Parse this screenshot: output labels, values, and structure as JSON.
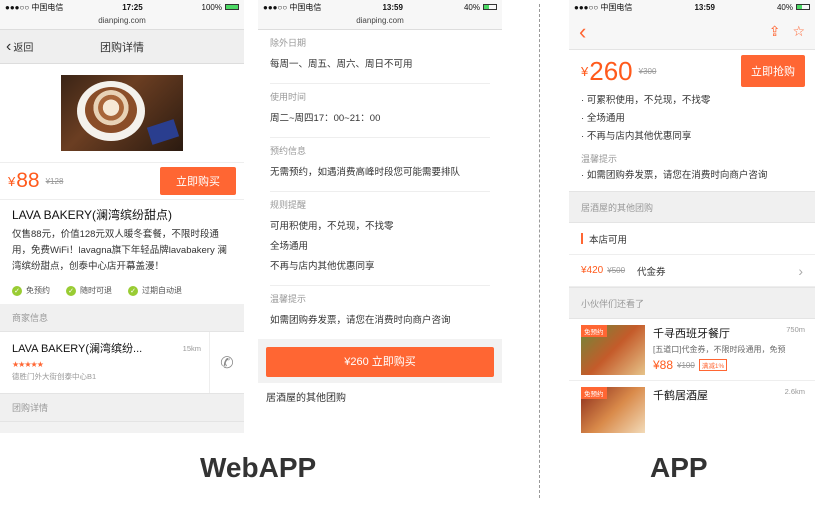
{
  "webapp_list": {
    "status": {
      "carrier": "●●●○○ 中国电信",
      "time": "17:25",
      "battery": "100%",
      "battery_level": 1.0
    },
    "url": "dianping.com",
    "nav": {
      "back": "返回",
      "title": "团购详情"
    },
    "price": {
      "currency": "¥",
      "value": "88",
      "old": "¥128",
      "buy": "立即购买"
    },
    "title": "LAVA BAKERY(澜湾缤纷甜点)",
    "desc": "仅售88元，价值128元双人暖冬套餐，不限时段通用，免费WiFi！lavagna旗下年轻品牌lavabakery 澜湾缤纷甜点，创泰中心店开幕盖漫！",
    "features": [
      "免预约",
      "随时可退",
      "过期自动退"
    ],
    "merchant_section": "商家信息",
    "shop": {
      "name": "LAVA BAKERY(澜湾缤纷...",
      "distance": "15km",
      "stars": "★★★★★",
      "address": "德胜门外大街创泰中心B1"
    },
    "deal_section": "团购详情"
  },
  "webapp_detail": {
    "status": {
      "carrier": "●●●○○ 中国电信",
      "time": "13:59",
      "battery": "40%",
      "battery_level": 0.4
    },
    "url": "dianping.com",
    "sections": [
      {
        "label": "除外日期",
        "value": "每周一、周五、周六、周日不可用"
      },
      {
        "label": "使用时间",
        "value": "周二~周四17：00~21：00"
      },
      {
        "label": "预约信息",
        "value": "无需预约，如遇消费高峰时段您可能需要排队"
      },
      {
        "label": "规则提醒",
        "lines": [
          "可用积使用，不兑现，不找零",
          "全场通用",
          "不再与店内其他优惠同享"
        ]
      },
      {
        "label": "温馨提示",
        "value": "如需团购券发票，请您在消费时向商户咨询"
      }
    ],
    "buy_button": "¥260 立即购买",
    "other_deals": "居酒屋的其他团购"
  },
  "app": {
    "status": {
      "carrier": "●●●○○ 中国电信",
      "time": "13:59",
      "battery": "40%",
      "battery_level": 0.4
    },
    "price": {
      "currency": "¥",
      "value": "260",
      "old": "¥300",
      "buy": "立即抢购"
    },
    "rules": [
      "可累积使用，不兑现，不找零",
      "全场通用",
      "不再与店内其他优惠同享"
    ],
    "tip_label": "温馨提示",
    "tip": "如需团购券发票，请您在消费时向商户咨询",
    "other_section": "居酒屋的其他团购",
    "store_available": "本店可用",
    "voucher": {
      "price": "¥420",
      "old": "¥500",
      "name": "代金券",
      "arrow": "›"
    },
    "recommend_section": "小伙伴们还看了",
    "recommendations": [
      {
        "tag": "免预约",
        "name": "千寻西班牙餐厅",
        "distance": "750m",
        "desc": "[五道口]代金券，不限时段通用，免预",
        "price": "¥88",
        "old": "¥100",
        "badge": "满减1%"
      },
      {
        "tag": "免预约",
        "name": "千鹤居酒屋",
        "distance": "2.6km",
        "desc": "",
        "price": "",
        "old": "",
        "badge": ""
      }
    ]
  },
  "captions": {
    "webapp": "WebAPP",
    "app": "APP"
  },
  "colors": {
    "accent": "#ff6633",
    "price": "#ff5a1c"
  }
}
